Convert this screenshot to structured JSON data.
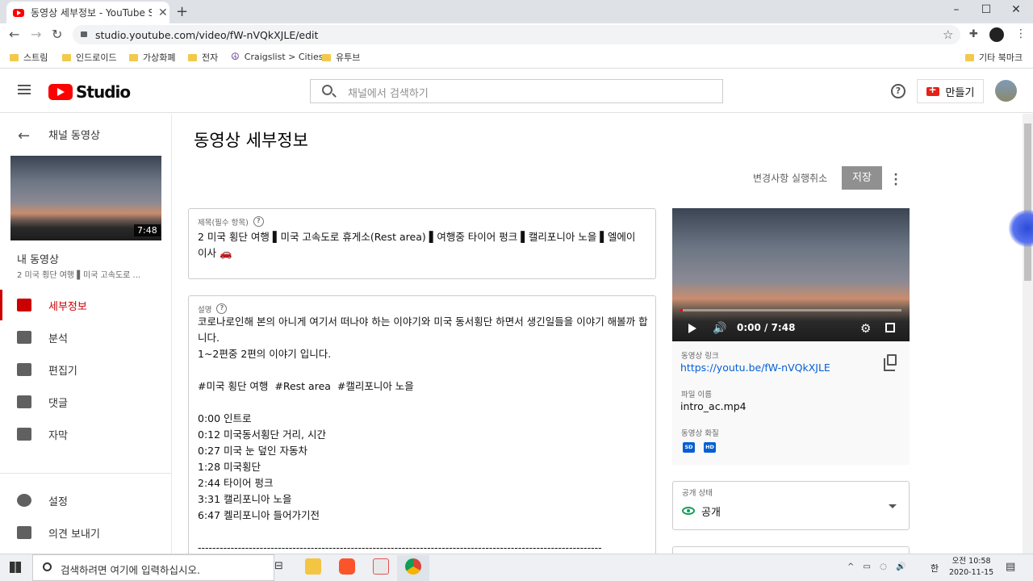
{
  "browser": {
    "tab_title": "동영상 세부정보 - YouTube Stu",
    "url": "studio.youtube.com/video/fW-nVQkXJLE/edit",
    "bookmarks": [
      "스트림",
      "인드로이드",
      "가상화폐",
      "전자",
      "Craigslist > Cities",
      "유투브"
    ],
    "other_bookmarks": "기타 북마크"
  },
  "header": {
    "logo_text": "Studio",
    "search_placeholder": "채널에서 검색하기",
    "help": "?",
    "create_label": "만들기"
  },
  "sidebar": {
    "back_label": "채널 동영상",
    "thumb_duration": "7:48",
    "my_video": "내 동영상",
    "video_subtitle": "2 미국 횡단 여행 ▌미국 고속도로 ...",
    "items": [
      {
        "label": "세부정보",
        "icon": "pencil-icon",
        "active": true
      },
      {
        "label": "분석",
        "icon": "analytics-icon",
        "active": false
      },
      {
        "label": "편집기",
        "icon": "editor-icon",
        "active": false
      },
      {
        "label": "댓글",
        "icon": "comments-icon",
        "active": false
      },
      {
        "label": "자막",
        "icon": "subtitles-icon",
        "active": false
      }
    ],
    "bottom_items": [
      {
        "label": "설정",
        "icon": "settings-icon"
      },
      {
        "label": "의견 보내기",
        "icon": "feedback-icon"
      }
    ]
  },
  "main": {
    "page_title": "동영상 세부정보",
    "undo_label": "변경사항 실행취소",
    "save_label": "저장",
    "title_label": "제목(필수 항목)",
    "title_value": "2 미국 횡단 여행 ▌미국 고속도로 휴게소(Rest area) ▌여행중 타이어 펑크 ▌캘리포니아 노을 ▌엘에이 이사 🚗",
    "desc_label": "설명",
    "desc_value": "코로나로인해 본의 아니게 여기서 떠나야 하는 이야기와 미국 동서횡단 하면서 생긴일들을 이야기 해볼까 합니다.\n1~2편중 2편의 이야기 입니다.\n\n#미국 횡단 여행  #Rest area  #캘리포니아 노을\n\n0:00 인트로\n0:12 미국동서횡단 거리, 시간\n0:27 미국 눈 덮인 자동차\n1:28 미국횡단\n2:44 타이어 펑크\n3:31 캘리포니아 노을\n6:47 켈리포니아 들어가기전\n\n---------------------------------------------------------------------------------------------------------------"
  },
  "video_panel": {
    "time": "0:00 / 7:48",
    "progress": 0.01,
    "link_label": "동영상 링크",
    "link": "https://youtu.be/fW-nVQkXJLE",
    "filename_label": "파일 이름",
    "filename": "intro_ac.mp4",
    "quality_label": "동영상 화질",
    "badges": [
      "SD",
      "HD"
    ]
  },
  "visibility": {
    "label": "공개 상태",
    "value": "공개"
  },
  "taskbar": {
    "search_placeholder": "검색하려면 여기에 입력하십시오.",
    "ime": "한",
    "time": "오전 10:58",
    "date": "2020-11-15"
  },
  "colors": {
    "accent": "#cc0000",
    "link": "#065fd4",
    "save_disabled": "#909090"
  }
}
